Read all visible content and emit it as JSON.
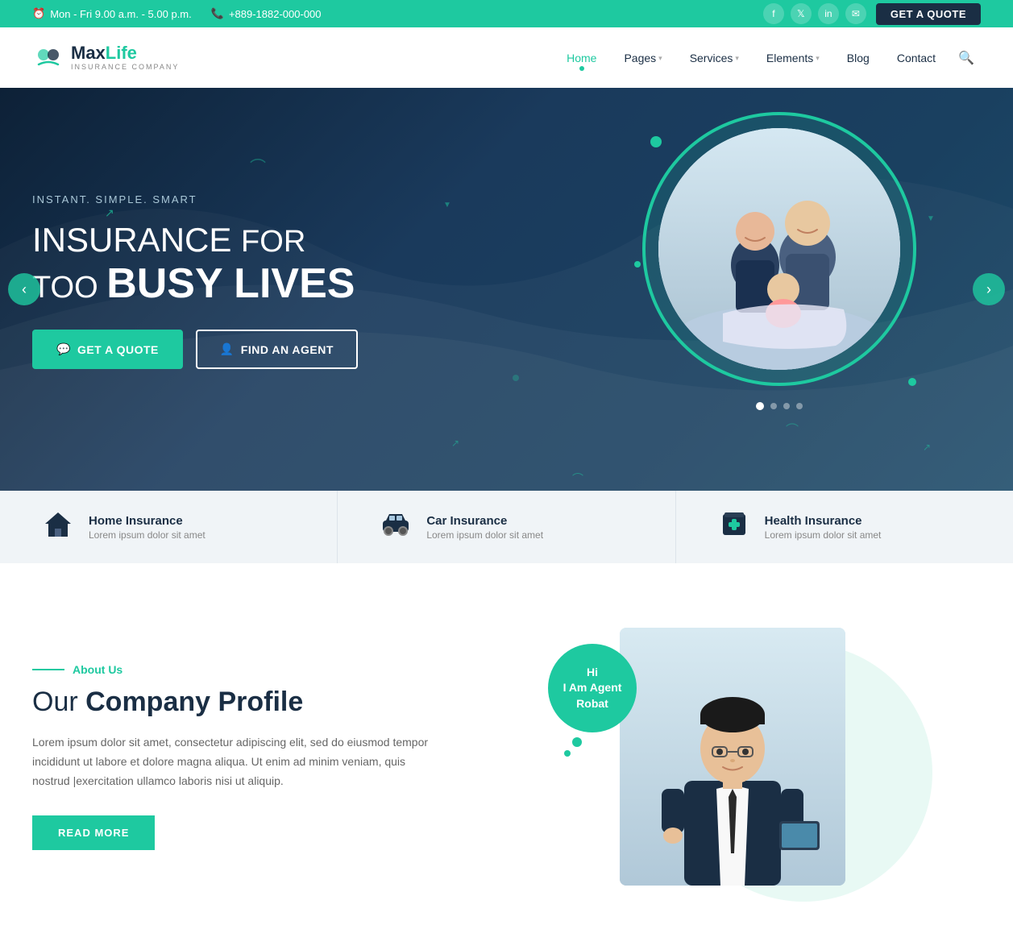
{
  "topbar": {
    "hours": "Mon - Fri 9.00 a.m. - 5.00 p.m.",
    "phone": "+889-1882-000-000",
    "get_quote": "GET A QUOTE",
    "socials": [
      "f",
      "t",
      "in",
      "✉"
    ]
  },
  "navbar": {
    "logo_max": "Max",
    "logo_life": "Life",
    "logo_sub": "INSURANCE COMPANY",
    "nav_items": [
      {
        "label": "Home",
        "has_dropdown": false,
        "active": true
      },
      {
        "label": "Pages",
        "has_dropdown": true,
        "active": false
      },
      {
        "label": "Services",
        "has_dropdown": true,
        "active": false
      },
      {
        "label": "Elements",
        "has_dropdown": true,
        "active": false
      },
      {
        "label": "Blog",
        "has_dropdown": false,
        "active": false
      },
      {
        "label": "Contact",
        "has_dropdown": false,
        "active": false
      }
    ]
  },
  "hero": {
    "tagline": "INSTANT. SIMPLE. SMART",
    "title_line1": "INSURANCE FOR",
    "title_line2_prefix": "TOO ",
    "title_line2_main": "BUSY LIVES",
    "btn_quote": "GET A QUOTE",
    "btn_agent": "FIND AN AGENT",
    "dots": [
      true,
      false,
      false,
      false
    ]
  },
  "insurance_strip": {
    "items": [
      {
        "icon": "🏠",
        "title": "Home Insurance",
        "desc": "Lorem ipsum dolor sit amet"
      },
      {
        "icon": "🚗",
        "title": "Car Insurance",
        "desc": "Lorem ipsum dolor sit amet"
      },
      {
        "icon": "🏥",
        "title": "Health Insurance",
        "desc": "Lorem ipsum dolor sit amet"
      }
    ]
  },
  "about": {
    "label": "About Us",
    "title_normal": "Our ",
    "title_bold": "Company Profile",
    "desc": "Lorem ipsum dolor sit amet, consectetur adipiscing elit, sed do eiusmod tempor incididunt ut labore et dolore magna aliqua. Ut enim ad minim veniam, quis nostrud |exercitation ullamco laboris nisi ut aliquip.",
    "btn_read_more": "READ MORE",
    "agent_greeting": "Hi",
    "agent_iam": "I Am Agent",
    "agent_name": "Robat"
  },
  "colors": {
    "teal": "#1ec9a0",
    "dark": "#1a2e44",
    "hero_bg": "#0d2137"
  }
}
